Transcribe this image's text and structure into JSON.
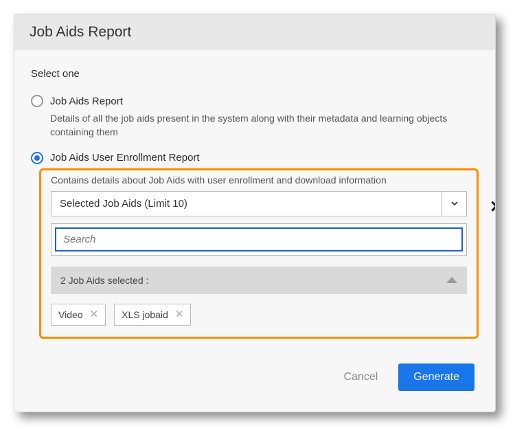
{
  "dialog": {
    "title": "Job Aids Report",
    "select_label": "Select one"
  },
  "options": {
    "report": {
      "label": "Job Aids Report",
      "desc": "Details of all the job aids present in the system along with their metadata and learning objects containing them"
    },
    "enrollment": {
      "label": "Job Aids User Enrollment Report",
      "desc": "Contains details about Job Aids with user enrollment and download information"
    }
  },
  "combo": {
    "label": "Selected Job Aids (Limit 10)"
  },
  "search": {
    "placeholder": "Search"
  },
  "selected": {
    "header": "2 Job Aids selected :",
    "chips": [
      "Video",
      "XLS jobaid"
    ]
  },
  "footer": {
    "cancel": "Cancel",
    "generate": "Generate"
  }
}
